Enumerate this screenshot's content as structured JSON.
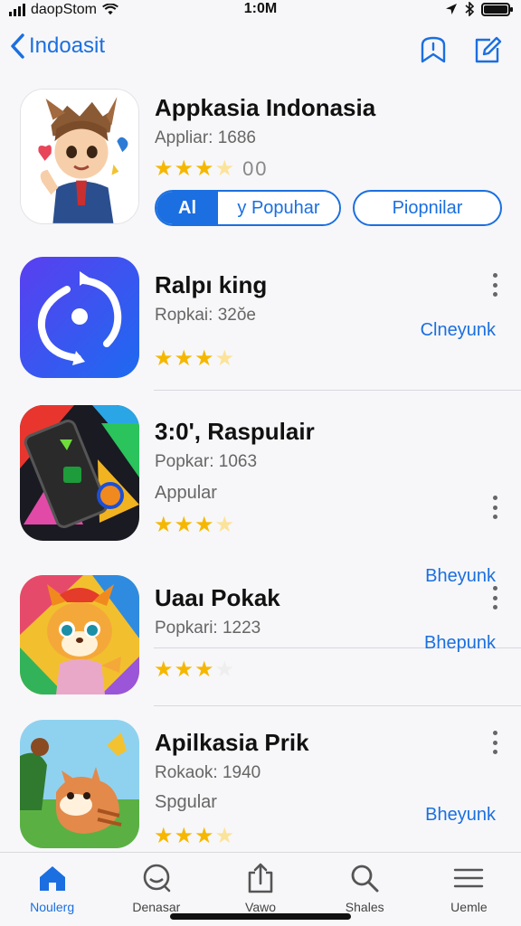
{
  "status_bar": {
    "carrier": "daopStom",
    "time": "1:0M"
  },
  "nav": {
    "back_label": "Indoasit",
    "icons": [
      "bookmark-icon",
      "compose-icon"
    ]
  },
  "apps": [
    {
      "name": "Appkasia Indonasia",
      "meta": "Appliar: 1686",
      "rating_label": "00",
      "stars": 3.5,
      "segment": {
        "left": "Al",
        "right": "y Popuhar"
      },
      "secondary_button": "Piopnilar"
    },
    {
      "name": "Ralpı king",
      "meta": "Ropkai: 32ŏe",
      "stars": 3.5,
      "get_label": "Clneyunk"
    },
    {
      "name": "3:0', Raspulair",
      "meta": "Popkar: 1063",
      "sub": "Appular",
      "stars": 3.5,
      "get_label": "Bheyunk"
    },
    {
      "name": "Uaaı Pokak",
      "meta": "Popkari: 1223",
      "stars": 3,
      "get_label": "Bhepunk"
    },
    {
      "name": "Apilkasia Prik",
      "meta": "Rokaok: 1940",
      "sub": "Spgular",
      "stars": 3.5,
      "get_label": "Bheyunk"
    }
  ],
  "tabs": [
    {
      "label": "Noulerg",
      "icon": "home-icon",
      "active": true
    },
    {
      "label": "Denasar",
      "icon": "discover-icon",
      "active": false
    },
    {
      "label": "Vawo",
      "icon": "share-icon",
      "active": false
    },
    {
      "label": "Shales",
      "icon": "search-icon",
      "active": false
    },
    {
      "label": "Uemle",
      "icon": "menu-icon",
      "active": false
    }
  ],
  "colors": {
    "accent": "#1b6fe0",
    "star": "#f5b700",
    "background": "#f7f7f9"
  }
}
